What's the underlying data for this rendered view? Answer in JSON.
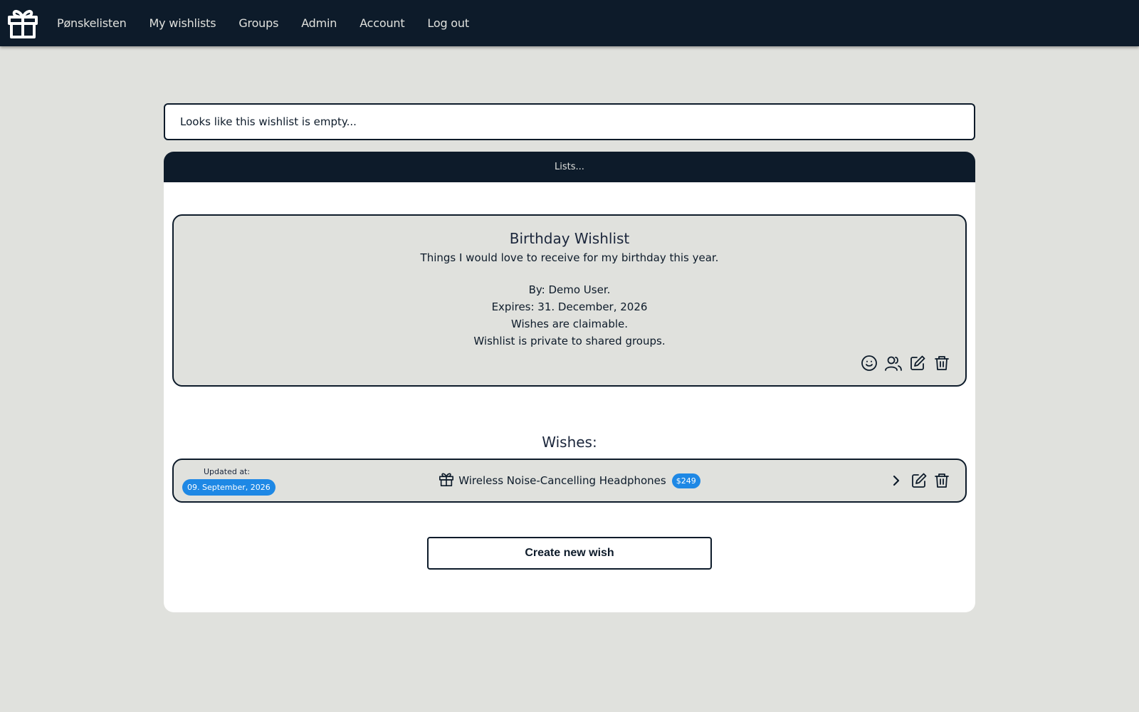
{
  "nav": {
    "brand": "Pønskelisten",
    "links": [
      "My wishlists",
      "Groups",
      "Admin",
      "Account",
      "Log out"
    ]
  },
  "notice": "Looks like this wishlist is empty...",
  "panel": {
    "header": "Lists..."
  },
  "wishlist": {
    "title": "Birthday Wishlist",
    "description": "Things I would love to receive for my birthday this year.",
    "by": "By: Demo User.",
    "expires": "Expires: 31. December, 2026",
    "claimable": "Wishes are claimable.",
    "privacy": "Wishlist is private to shared groups."
  },
  "wishes": {
    "heading": "Wishes:",
    "items": [
      {
        "updated_label": "Updated at:",
        "updated_date": "09. September, 2026",
        "name": "Wireless Noise-Cancelling Headphones",
        "price": "$249"
      }
    ]
  },
  "create_button": "Create new wish",
  "colors": {
    "navbar": "#0d1b2a",
    "background": "#e0e1dd",
    "accent": "#1e88e5"
  }
}
